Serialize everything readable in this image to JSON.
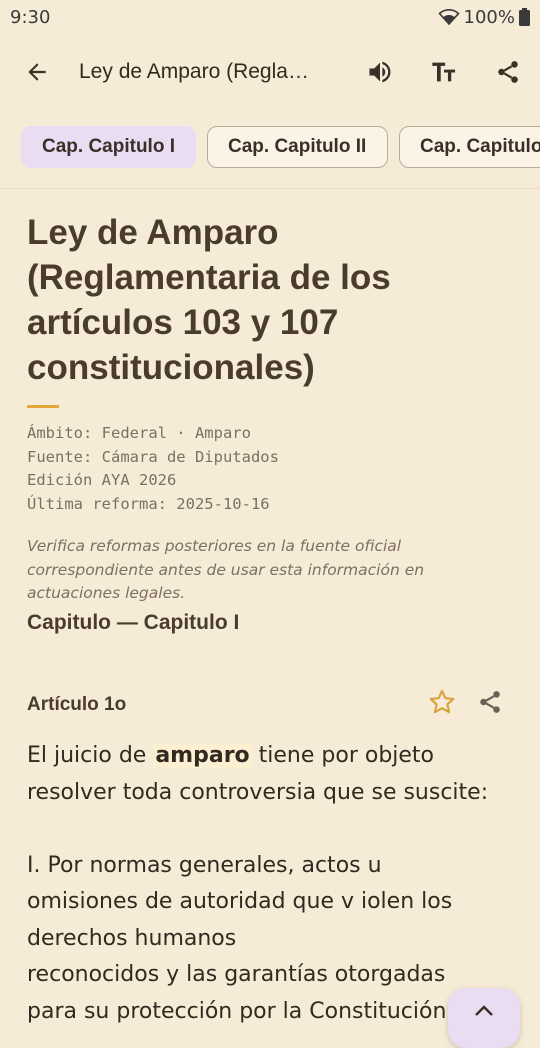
{
  "status_bar": {
    "time": "9:30",
    "battery": "100%"
  },
  "app_bar": {
    "title": "Ley de Amparo (Regla…",
    "icons": [
      "arrow-back-icon",
      "volume-up-icon",
      "text-size-icon",
      "share-icon"
    ]
  },
  "chapter_tabs": [
    {
      "label": "Cap. Capitulo I",
      "selected": true
    },
    {
      "label": "Cap. Capitulo II",
      "selected": false
    },
    {
      "label": "Cap. Capitulo III",
      "selected": false
    }
  ],
  "document": {
    "title": "Ley de Amparo (Reglamentaria de los artículos 103 y 107 constitucionales)",
    "meta": [
      "Ámbito: Federal · Amparo",
      "Fuente: Cámara de Diputados",
      "Edición AYA 2026",
      "Última reforma: 2025-10-16"
    ],
    "disclaimer_lines": [
      "Verifica reformas posteriores en la fuente oficial",
      "correspondiente antes de usar esta información en",
      "actuaciones legales."
    ]
  },
  "chapter_heading": "Capitulo — Capitulo I",
  "article": {
    "label": "Artículo 1o",
    "line1_before": "El juicio de ",
    "line1_highlight": "amparo",
    "line1_after": " tiene por objeto",
    "line2": "resolver toda controversia que se suscite:",
    "line3": "I. Por normas generales, actos u",
    "line4": "omisiones de autoridad que v iolen los",
    "line5": "derechos humanos",
    "line6": "reconocidos y las garantías otorgadas",
    "line7": "para su protección por la Constitución"
  },
  "colors": {
    "background": "#f6ebd6",
    "accent": "#e0a93a",
    "chip_selected": "#eadcf2",
    "highlight": "#fbf0d2"
  }
}
